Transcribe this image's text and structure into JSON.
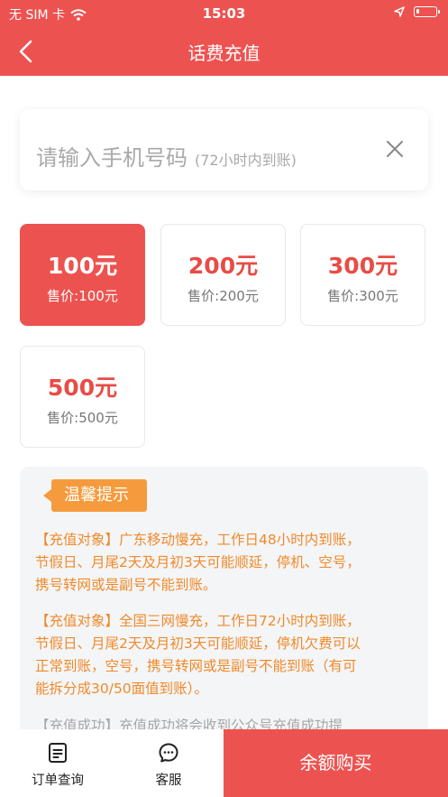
{
  "status_bar": {
    "carrier": "无 SIM 卡",
    "time": "15:03",
    "battery_level": 0.15
  },
  "nav": {
    "title": "话费充值"
  },
  "phone": {
    "value": "",
    "placeholder_main": "请输入手机号码",
    "placeholder_sub": "(72小时内到账)"
  },
  "amounts": [
    {
      "value": "100元",
      "price": "售价:100元",
      "selected": true
    },
    {
      "value": "200元",
      "price": "售价:200元",
      "selected": false
    },
    {
      "value": "300元",
      "price": "售价:300元",
      "selected": false
    },
    {
      "value": "500元",
      "price": "售价:500元",
      "selected": false
    }
  ],
  "tips": {
    "tag": "温馨提示",
    "paragraphs": [
      [
        "【充值对象】广东移动慢充，工作日48小时内到账，",
        "节假日、月尾2天及月初3天可能顺延，停机、空号，",
        "携号转网或是副号不能到账。"
      ],
      [
        "【充值对象】全国三网慢充，工作日72小时内到账，",
        "节假日、月尾2天及月初3天可能顺延，停机欠费可以",
        "正常到账，空号，携号转网或是副号不能到账（有可",
        "能拆分成30/50面值到账）。"
      ],
      [
        "【充值成功】充值成功将会收到公众号充值成功提"
      ]
    ]
  },
  "bottom": {
    "orders_label": "订单查询",
    "service_label": "客服",
    "buy_label": "余额购买"
  },
  "colors": {
    "primary": "#ec5350",
    "tip_orange": "#f08a2a",
    "tag_orange": "#f59b3d"
  }
}
